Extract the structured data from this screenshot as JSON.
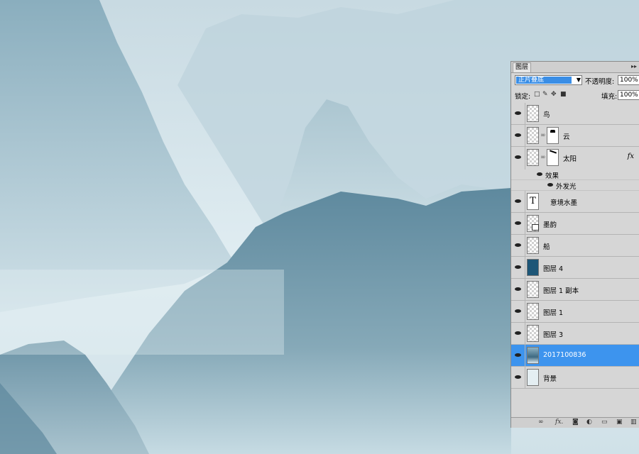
{
  "panel": {
    "tab_label": "图层",
    "collapse_glyph": "▸▸",
    "blend_mode": "正片叠底",
    "opacity_label": "不透明度:",
    "opacity_value": "100%",
    "lock_label": "锁定:",
    "fill_label": "填充:",
    "fill_value": "100%"
  },
  "layers": [
    {
      "name": "鸟",
      "thumb": "transparent"
    },
    {
      "name": "云",
      "thumb": "transparent",
      "mask": true
    },
    {
      "name": "太阳",
      "thumb": "transparent",
      "mask": true,
      "fx": "fx"
    },
    {
      "name": "意境水墨",
      "thumb": "text",
      "thumb_glyph": "T"
    },
    {
      "name": "墨韵",
      "thumb": "smart"
    },
    {
      "name": "船",
      "thumb": "transparent"
    },
    {
      "name": "图层 4",
      "thumb": "solid",
      "thumb_color": "#1d5677"
    },
    {
      "name": "图层 1 副本",
      "thumb": "transparent"
    },
    {
      "name": "图层 1",
      "thumb": "transparent"
    },
    {
      "name": "图层 3",
      "thumb": "transparent"
    },
    {
      "name": "2017100836",
      "thumb": "photo",
      "selected": true
    },
    {
      "name": "背景",
      "thumb": "solid",
      "thumb_color": "#e4eef2"
    }
  ],
  "effects": {
    "label": "效果",
    "items": [
      "外发光"
    ]
  },
  "colors": {
    "selection": "#3d94ee",
    "panel_bg": "#d6d6d6",
    "sky": "#d7e6ec",
    "mountain_far": "#b3ccd6",
    "mountain_mid": "#7fa4b5",
    "mountain_near": "#5f8aa0"
  },
  "icons": {
    "eye": "eye-icon",
    "chain": "link-icon",
    "lock_transparent": "lock-transparent-icon",
    "lock_paint": "brush-icon",
    "lock_move": "move-icon",
    "lock_all": "lock-icon",
    "bottom": [
      "link-layers-icon",
      "fx-icon",
      "mask-icon",
      "adjustment-icon",
      "group-folder-icon",
      "new-layer-icon",
      "trash-icon"
    ]
  }
}
